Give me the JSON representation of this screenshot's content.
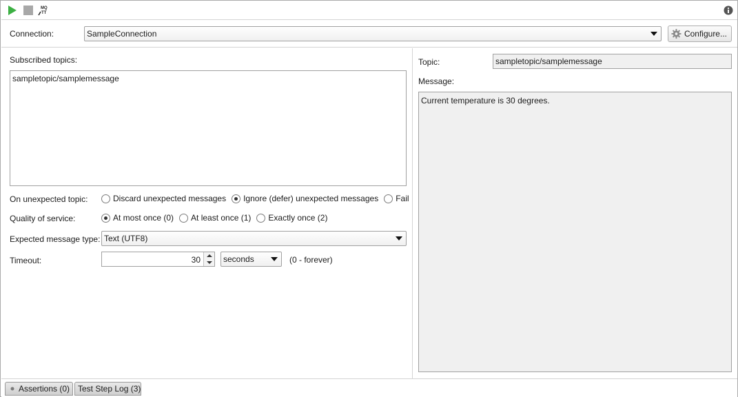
{
  "toolbar": {
    "icons": [
      "play-icon",
      "stop-icon",
      "mqtt-icon",
      "info-icon"
    ],
    "mqtt_text": "MQTT",
    "play_color": "#3cb043"
  },
  "connection": {
    "label": "Connection:",
    "value": "SampleConnection",
    "configure_label": "Configure..."
  },
  "subscribed": {
    "label": "Subscribed topics:",
    "topics": "sampletopic/samplemessage"
  },
  "unexpected": {
    "label": "On unexpected topic:",
    "options": [
      "Discard unexpected messages",
      "Ignore (defer) unexpected messages",
      "Fail"
    ],
    "selected": 1
  },
  "qos": {
    "label": "Quality of service:",
    "options": [
      "At most once (0)",
      "At least once (1)",
      "Exactly once (2)"
    ],
    "selected": 0
  },
  "message_type": {
    "label": "Expected message type:",
    "value": "Text (UTF8)"
  },
  "timeout": {
    "label": "Timeout:",
    "value": "30",
    "unit": "seconds",
    "hint": "(0 - forever)"
  },
  "right": {
    "topic_label": "Topic:",
    "topic_value": "sampletopic/samplemessage",
    "message_label": "Message:",
    "message_value": "Current temperature is 30 degrees."
  },
  "tabs": {
    "assertions": "Assertions (0)",
    "log": "Test Step Log (3)"
  }
}
